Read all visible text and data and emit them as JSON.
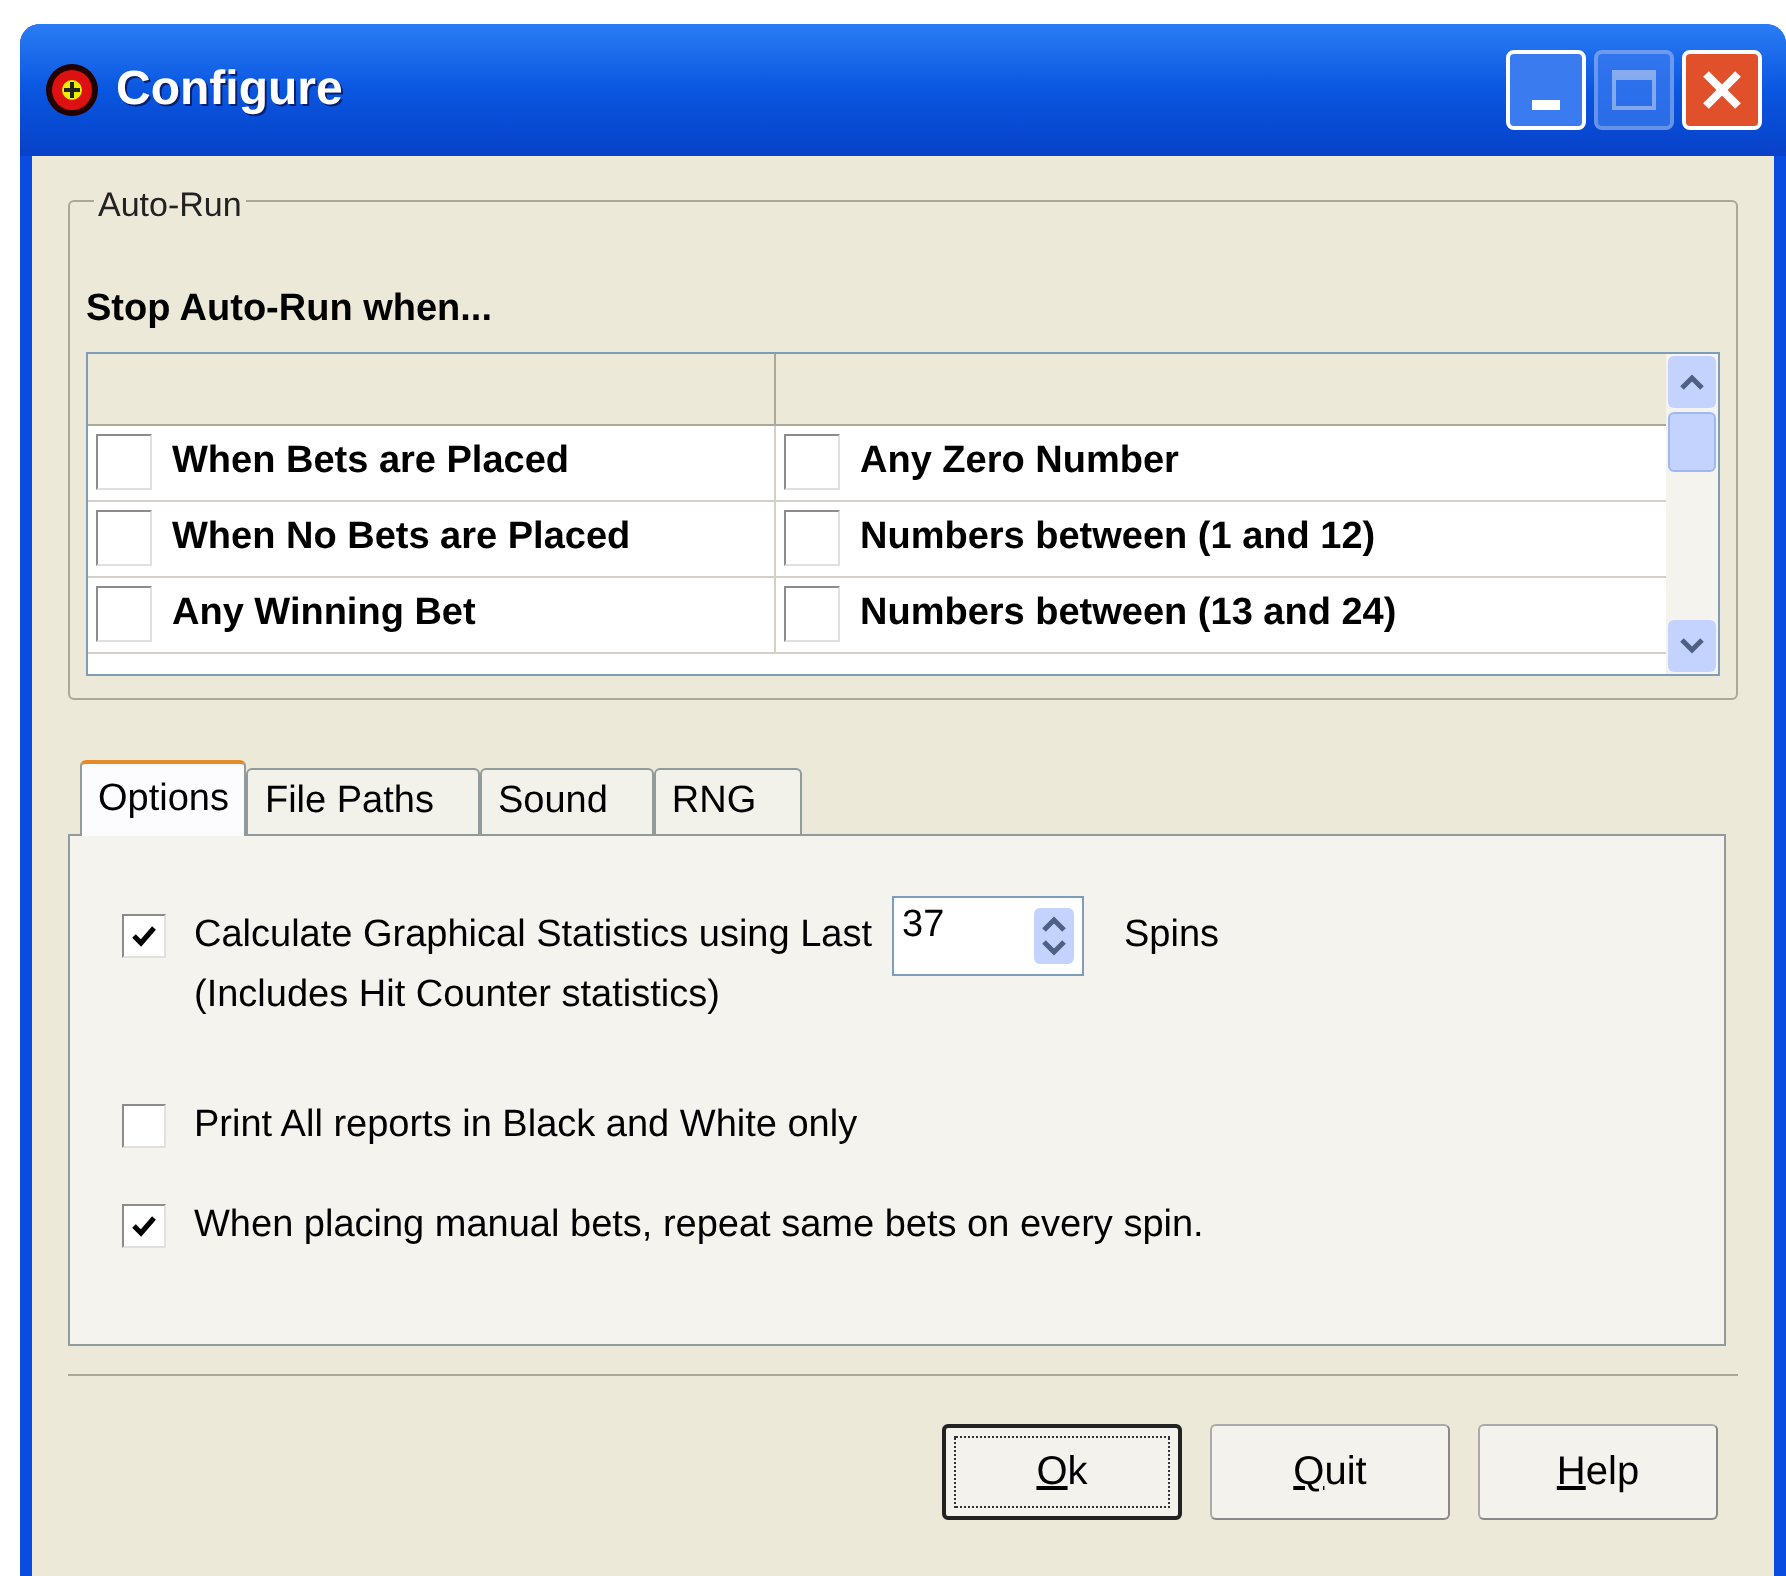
{
  "window": {
    "title": "Configure"
  },
  "auto_run": {
    "group_title": "Auto-Run",
    "heading": "Stop Auto-Run when...",
    "rows": [
      {
        "left": {
          "label": "When Bets are Placed",
          "checked": false
        },
        "right": {
          "label": "Any Zero Number",
          "checked": false
        }
      },
      {
        "left": {
          "label": "When No Bets are Placed",
          "checked": false
        },
        "right": {
          "label": "Numbers between (1 and 12)",
          "checked": false
        }
      },
      {
        "left": {
          "label": "Any Winning Bet",
          "checked": false
        },
        "right": {
          "label": "Numbers between (13 and 24)",
          "checked": false
        }
      }
    ]
  },
  "tabs": [
    {
      "label": "Options",
      "selected": true
    },
    {
      "label": "File Paths",
      "selected": false
    },
    {
      "label": "Sound",
      "selected": false
    },
    {
      "label": "RNG",
      "selected": false
    }
  ],
  "options": {
    "stats": {
      "label": "Calculate Graphical Statistics using Last",
      "checked": true,
      "value": "37",
      "suffix": "Spins",
      "note": "(Includes Hit Counter statistics)"
    },
    "bw": {
      "label": "Print All reports in Black and White only",
      "checked": false
    },
    "repeat": {
      "label": "When placing manual bets, repeat same bets on every spin.",
      "checked": true
    }
  },
  "buttons": [
    {
      "label": "Ok",
      "default": true
    },
    {
      "label": "Quit",
      "default": false
    },
    {
      "label": "Help",
      "default": false
    }
  ]
}
